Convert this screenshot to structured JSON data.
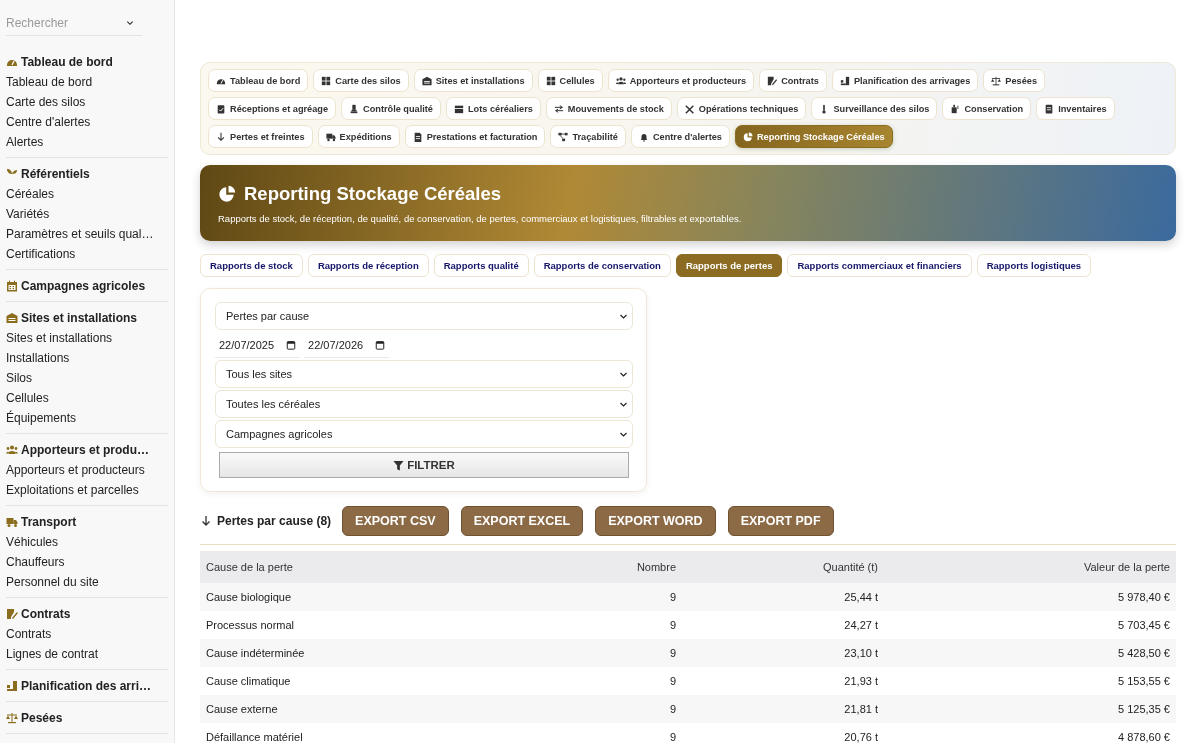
{
  "sidebar": {
    "search": {
      "placeholder": "Rechercher"
    },
    "sections": [
      {
        "title": "Tableau de bord",
        "items": [
          "Tableau de bord",
          "Carte des silos",
          "Centre d'alertes",
          "Alertes"
        ]
      },
      {
        "title": "Référentiels",
        "items": [
          "Céréales",
          "Variétés",
          "Paramètres et seuils qual…",
          "Certifications"
        ]
      },
      {
        "title": "Campagnes agricoles"
      },
      {
        "title": "Sites et installations",
        "items": [
          "Sites et installations",
          "Installations",
          "Silos",
          "Cellules",
          "Équipements"
        ]
      },
      {
        "title": "Apporteurs et produ…",
        "items": [
          "Apporteurs et producteurs",
          "Exploitations et parcelles"
        ]
      },
      {
        "title": "Transport",
        "items": [
          "Véhicules",
          "Chauffeurs",
          "Personnel du site"
        ]
      },
      {
        "title": "Contrats",
        "items": [
          "Contrats",
          "Lignes de contrat"
        ]
      },
      {
        "title": "Planification des arri…"
      },
      {
        "title": "Pesées"
      }
    ]
  },
  "module_tabs": [
    {
      "label": "Tableau de bord",
      "selected": false
    },
    {
      "label": "Carte des silos",
      "selected": false
    },
    {
      "label": "Sites et installations",
      "selected": false
    },
    {
      "label": "Cellules",
      "selected": false
    },
    {
      "label": "Apporteurs et producteurs",
      "selected": false
    },
    {
      "label": "Contrats",
      "selected": false
    },
    {
      "label": "Planification des arrivages",
      "selected": false
    },
    {
      "label": "Pesées",
      "selected": false
    },
    {
      "label": "Réceptions et agréage",
      "selected": false
    },
    {
      "label": "Contrôle qualité",
      "selected": false
    },
    {
      "label": "Lots céréaliers",
      "selected": false
    },
    {
      "label": "Mouvements de stock",
      "selected": false
    },
    {
      "label": "Opérations techniques",
      "selected": false
    },
    {
      "label": "Surveillance des silos",
      "selected": false
    },
    {
      "label": "Conservation",
      "selected": false
    },
    {
      "label": "Inventaires",
      "selected": false
    },
    {
      "label": "Pertes et freintes",
      "selected": false
    },
    {
      "label": "Expéditions",
      "selected": false
    },
    {
      "label": "Prestations et facturation",
      "selected": false
    },
    {
      "label": "Traçabilité",
      "selected": false
    },
    {
      "label": "Centre d'alertes",
      "selected": false
    },
    {
      "label": "Reporting Stockage Céréales",
      "selected": true
    }
  ],
  "banner": {
    "title": "Reporting Stockage Céréales",
    "subtitle": "Rapports de stock, de réception, de qualité, de conservation, de pertes, commerciaux et logistiques, filtrables et exportables."
  },
  "report_tabs": [
    {
      "label": "Rapports de stock",
      "selected": false
    },
    {
      "label": "Rapports de réception",
      "selected": false
    },
    {
      "label": "Rapports qualité",
      "selected": false
    },
    {
      "label": "Rapports de conservation",
      "selected": false
    },
    {
      "label": "Rapports de pertes",
      "selected": true
    },
    {
      "label": "Rapports commerciaux et financiers",
      "selected": false
    },
    {
      "label": "Rapports logistiques",
      "selected": false
    }
  ],
  "filters": {
    "report": "Pertes par cause",
    "date_from": "22/07/2025",
    "date_to": "22/07/2026",
    "site": "Tous les sites",
    "cereal": "Toutes les céréales",
    "campaign": "Campagnes agricoles",
    "button": "FILTRER"
  },
  "results": {
    "title": "Pertes par cause (8)",
    "exports": [
      "EXPORT CSV",
      "EXPORT EXCEL",
      "EXPORT WORD",
      "EXPORT PDF"
    ]
  },
  "table": {
    "columns": [
      "Cause de la perte",
      "Nombre",
      "Quantité (t)",
      "Valeur de la perte"
    ],
    "rows": [
      [
        "Cause biologique",
        "9",
        "25,44 t",
        "5 978,40 €"
      ],
      [
        "Processus normal",
        "9",
        "24,27 t",
        "5 703,45 €"
      ],
      [
        "Cause indéterminée",
        "9",
        "23,10 t",
        "5 428,50 €"
      ],
      [
        "Cause climatique",
        "9",
        "21,93 t",
        "5 153,55 €"
      ],
      [
        "Cause externe",
        "9",
        "21,81 t",
        "5 125,35 €"
      ],
      [
        "Défaillance matériel",
        "9",
        "20,76 t",
        "4 878,60 €"
      ]
    ]
  }
}
